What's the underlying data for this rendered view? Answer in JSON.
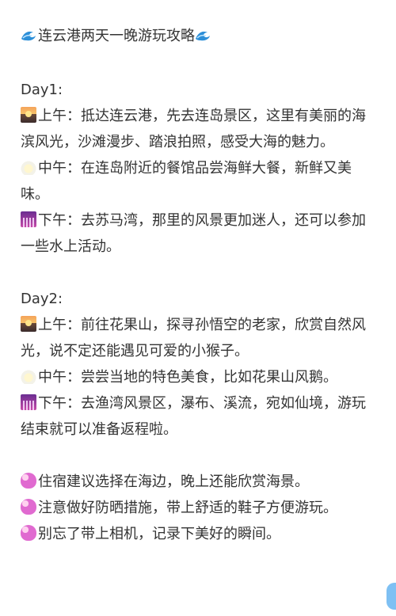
{
  "title": "连云港两天一晚游玩攻略",
  "day1": {
    "heading": "Day1:",
    "morning": "上午：抵达连云港，先去连岛景区，这里有美丽的海滨风光，沙滩漫步、踏浪拍照，感受大海的魅力。",
    "noon": "中午：在连岛附近的餐馆品尝海鲜大餐，新鲜又美味。",
    "afternoon": "下午：去苏马湾，那里的风景更加迷人，还可以参加一些水上活动。"
  },
  "day2": {
    "heading": "Day2:",
    "morning": "上午：前往花果山，探寻孙悟空的老家，欣赏自然风光，说不定还能遇见可爱的小猴子。",
    "noon": "中午：尝尝当地的特色美食，比如花果山风鹅。",
    "afternoon": "下午：去渔湾风景区，瀑布、溪流，宛如仙境，游玩结束就可以准备返程啦。"
  },
  "tips": [
    "住宿建议选择在海边，晚上还能欣赏海景。",
    "注意做好防晒措施，带上舒适的鞋子方便游玩。",
    "别忘了带上相机，记录下美好的瞬间。"
  ],
  "icons": {
    "title_left": "wave-icon",
    "title_right": "wave-icon",
    "morning": "sunrise-icon",
    "noon": "sun-icon",
    "afternoon": "city-dusk-icon",
    "tips": "sparkling-heart-icon"
  }
}
